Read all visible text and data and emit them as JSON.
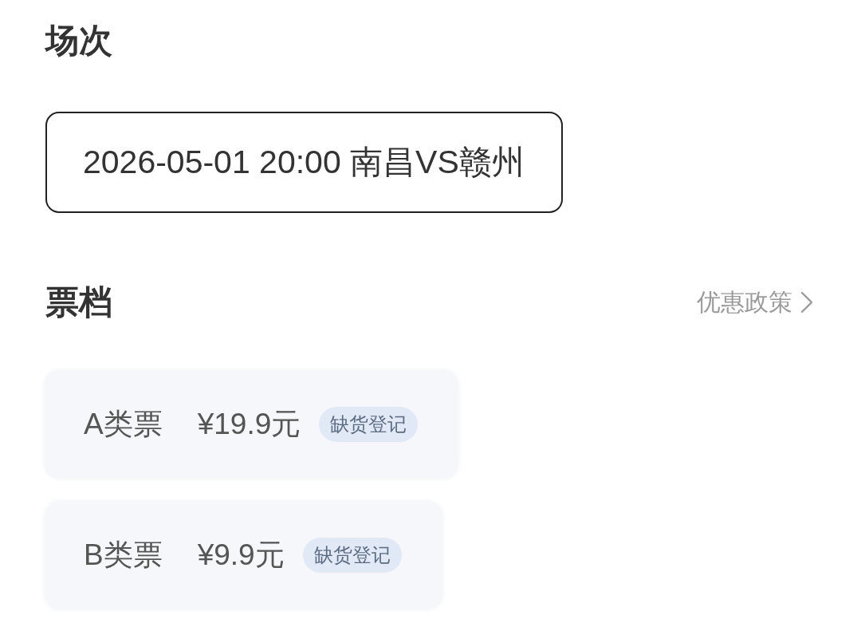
{
  "session_section": {
    "heading": "场次",
    "sessions": [
      {
        "label": "2026-05-01 20:00 南昌VS赣州",
        "selected": true
      }
    ]
  },
  "ticket_section": {
    "heading": "票档",
    "link": "优惠政策",
    "options": [
      {
        "name": "A类票",
        "price": "¥19.9元",
        "action": "缺货登记",
        "selected": false
      },
      {
        "name": "B类票",
        "price": "¥9.9元",
        "action": "缺货登记",
        "selected": false
      }
    ]
  }
}
